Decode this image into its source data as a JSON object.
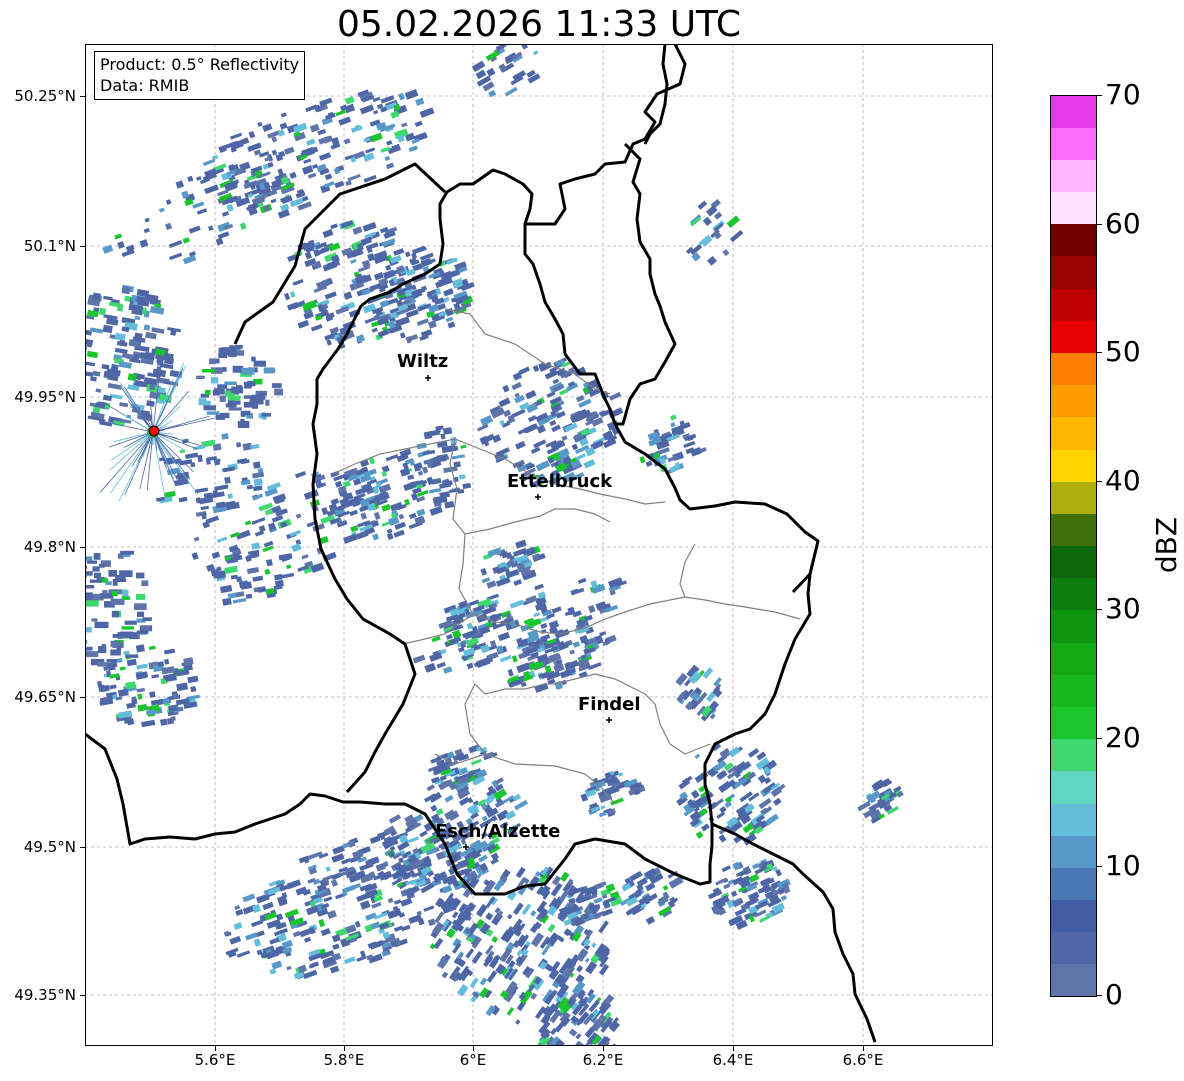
{
  "title": "05.02.2026 11:33 UTC",
  "info_box": {
    "product": "Product: 0.5° Reflectivity",
    "data": "Data: RMIB"
  },
  "latitude_labels": [
    "50.25°N",
    "50.1°N",
    "49.95°N",
    "49.8°N",
    "49.65°N",
    "49.5°N",
    "49.35°N"
  ],
  "longitude_labels": [
    "5.6°E",
    "5.8°E",
    "6°E",
    "6.2°E",
    "6.4°E",
    "6.6°E"
  ],
  "cities": [
    {
      "name": "Wiltz"
    },
    {
      "name": "Ettelbruck"
    },
    {
      "name": "Findel"
    },
    {
      "name": "Esch/Alzette"
    }
  ],
  "radar_site_color": "#ff0000",
  "colorbar": {
    "unit_label": "dBZ",
    "tick_labels": [
      "0",
      "10",
      "20",
      "30",
      "40",
      "50",
      "60",
      "70"
    ],
    "colors": [
      "#5f74a9",
      "#4e66a6",
      "#405ca5",
      "#4a78b4",
      "#5798c8",
      "#64bddb",
      "#5fd6c2",
      "#3fd86f",
      "#19c62b",
      "#15b91f",
      "#13a915",
      "#0f9411",
      "#0b7e0e",
      "#0a680b",
      "#406e0b",
      "#aeae0d",
      "#ffd400",
      "#ffb800",
      "#ff9b00",
      "#ff7f00",
      "#e60000",
      "#bf0000",
      "#990000",
      "#730000",
      "#ffe1ff",
      "#ffb6ff",
      "#ff6cff",
      "#e63ae6"
    ]
  },
  "colors": {
    "border": "#000000",
    "canton_lines": "#808080",
    "gridlines": "#b0b0b0",
    "echo_weak": "#4e66a6",
    "echo_light": "#64bddb",
    "echo_moderate": "#19c62b"
  }
}
